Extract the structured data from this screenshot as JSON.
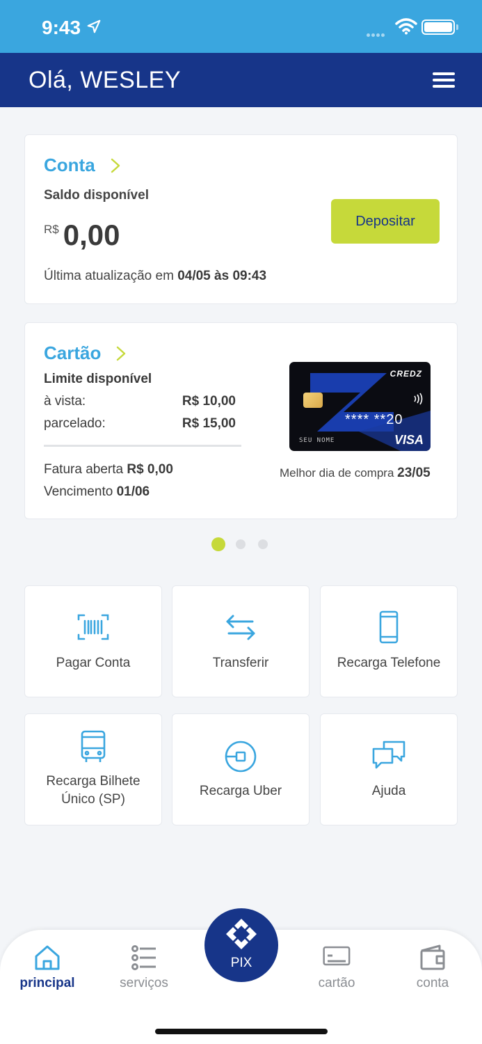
{
  "status_bar": {
    "time": "9:43"
  },
  "header": {
    "greeting": "Olá, WESLEY"
  },
  "conta": {
    "title": "Conta",
    "balance_label": "Saldo disponível",
    "currency": "R$",
    "balance": "0,00",
    "update_prefix": "Última atualização em",
    "update_value": "04/05 às 09:43",
    "deposit_button": "Depositar"
  },
  "cartao": {
    "title": "Cartão",
    "limit_title": "Limite disponível",
    "avista_label": "à vista:",
    "avista_value": "R$ 10,00",
    "parcelado_label": "parcelado:",
    "parcelado_value": "R$ 15,00",
    "fatura_label": "Fatura aberta",
    "fatura_value": "R$ 0,00",
    "vencimento_label": "Vencimento",
    "vencimento_value": "01/06",
    "best_day_label": "Melhor dia de compra",
    "best_day_value": "23/05",
    "card": {
      "brand": "CREDZ",
      "number": "**** **20",
      "holder": "SEU NOME",
      "network": "VISA"
    }
  },
  "carousel": {
    "pages": 3,
    "active": 0
  },
  "actions": [
    {
      "label": "Pagar Conta",
      "icon": "barcode-icon"
    },
    {
      "label": "Transferir",
      "icon": "transfer-arrows-icon"
    },
    {
      "label": "Recarga Telefone",
      "icon": "phone-icon"
    },
    {
      "label": "Recarga Bilhete Único (SP)",
      "icon": "bus-icon"
    },
    {
      "label": "Recarga Uber",
      "icon": "uber-icon"
    },
    {
      "label": "Ajuda",
      "icon": "chat-bubbles-icon"
    }
  ],
  "bottom_nav": {
    "principal": "principal",
    "servicos": "serviços",
    "pix": "PIX",
    "cartao": "cartão",
    "conta": "conta"
  },
  "colors": {
    "status_bar": "#3aa6df",
    "header": "#173589",
    "accent_blue": "#3aa6df",
    "accent_green": "#c6d93a",
    "navy": "#173589"
  }
}
